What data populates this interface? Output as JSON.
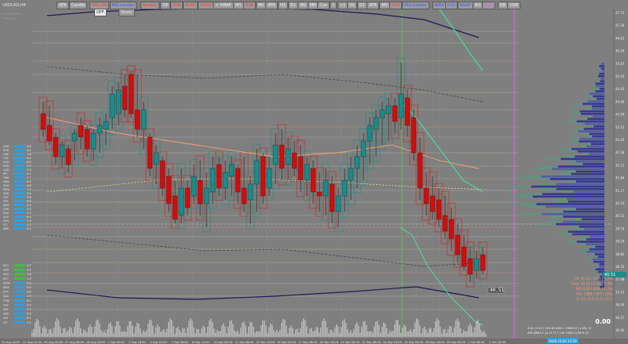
{
  "window": {
    "symbol_label": "USDCAD,H4",
    "row1_labels": [
      "—",
      "—",
      "—",
      "—",
      "—"
    ],
    "row2_labels": [
      "—",
      "—",
      "—",
      "—"
    ]
  },
  "toolbar": {
    "buttons": [
      {
        "label": "ATR",
        "color": "#f6f6f6"
      },
      {
        "label": "Candle",
        "color": "#f6f6f6"
      },
      {
        "label": "TRG DN",
        "color": "#ff3a3a"
      },
      {
        "label": "Mid London",
        "color": "#3a5aff"
      },
      {
        "label": "Weekly",
        "color": "#ff3a3a"
      },
      {
        "label": "SR",
        "color": "#f6f6f6"
      },
      {
        "label": "Q28",
        "color": "#ff3a3a"
      },
      {
        "label": "AVRP",
        "color": "#ff3a3a"
      },
      {
        "label": "VWAP",
        "color": "#ff3a3a"
      },
      {
        "label": "< VWAP",
        "color": "#f6f6f6"
      },
      {
        "label": "M1",
        "color": "#f6f6f6"
      },
      {
        "label": "Q28",
        "color": "#ff3a3a"
      },
      {
        "label": "MV",
        "color": "#f6f6f6"
      },
      {
        "label": "ATR",
        "color": "#f6f6f6"
      },
      {
        "label": "H1",
        "color": "#f6f6f6"
      },
      {
        "label": "D1",
        "color": "#f6f6f6"
      },
      {
        "label": "W1",
        "color": "#f6f6f6"
      },
      {
        "label": "MN",
        "color": "#f6f6f6"
      },
      {
        "label": "Cov",
        "color": "#f6f6f6"
      },
      {
        "label": "1",
        "color": "#f6f6f6"
      },
      {
        "label": "<1",
        "color": "#f6f6f6"
      },
      {
        "label": "D1",
        "color": "#f6f6f6"
      },
      {
        "label": "D1",
        "color": "#f6f6f6"
      },
      {
        "label": "ATR",
        "color": "#f6f6f6"
      },
      {
        "label": "MV",
        "color": "#f6f6f6"
      },
      {
        "label": "Q28",
        "color": "#ff3a3a"
      },
      {
        "label": "Mid London",
        "color": "#3a5aff"
      },
      {
        "label": "WB3",
        "color": "#3a5aff"
      },
      {
        "label": "H12",
        "color": "#3a5aff"
      },
      {
        "label": "NGAP",
        "color": "#3a5aff"
      },
      {
        "label": "W1",
        "color": "#f6f6f6"
      },
      {
        "label": "S Pa",
        "color": "#ff5aff"
      },
      {
        "label": "DB",
        "color": "#f6f6f6"
      },
      {
        "label": "COR",
        "color": "#f6f6f6"
      }
    ],
    "off_label": "OFF",
    "boxes_label": "Boxes"
  },
  "time_axis": [
    "20 Aug 2020",
    "22 Aug 12:00",
    "25 Aug 00:00",
    "27 Aug 08:00",
    "28 Aug 16:00",
    "1 Sep 00:00",
    "3 Sep 16:00",
    "4 Sep 20:00",
    "7 Sep 08:00",
    "8 Sep 12:00",
    "10 Sep 00:00",
    "11 Sep 08:00",
    "14 Sep 16:00",
    "16 Sep 00:00",
    "17 Sep 08:00",
    "18 Sep 16:00",
    "21 Sep 00:00",
    "22 Sep 08:00",
    "24 Sep 16:00",
    "25 Sep 00:00",
    "28 Sep 16:00",
    "30 Sep 00:00",
    "1 Oct 08:00",
    "2 Oct 16:00"
  ],
  "price_axis": [
    "47.75",
    "47.28",
    "46.81",
    "46.34",
    "45.87",
    "45.40",
    "44.93",
    "44.46",
    "43.99",
    "43.52",
    "43.05",
    "42.58",
    "42.11",
    "41.64",
    "41.17",
    "40.70",
    "40.23",
    "39.76",
    "39.29",
    "38.82",
    "38.35",
    "37.88",
    "37.41",
    "36.94",
    "36.47",
    "36.00"
  ],
  "current_price": "40.51",
  "pivot_label": "40.51",
  "currency_strength": {
    "rows": [
      {
        "name": "USD",
        "value": "3.6"
      },
      {
        "name": "EUR",
        "value": "4.2"
      },
      {
        "name": "GBP",
        "value": "7.8"
      },
      {
        "name": "CHF",
        "value": "5.4"
      },
      {
        "name": "AUD",
        "value": "6.0"
      },
      {
        "name": "NZD",
        "value": "3.9"
      },
      {
        "name": "CAD",
        "value": "2.9"
      },
      {
        "name": "JPY",
        "value": "5.1"
      },
      {
        "name": "CNH",
        "value": "2.7"
      },
      {
        "name": "HKD",
        "value": "6.3"
      },
      {
        "name": "SGD",
        "value": "4.8"
      },
      {
        "name": "MXN",
        "value": "7.1"
      },
      {
        "name": "ZAR",
        "value": "3.4"
      },
      {
        "name": "TRY",
        "value": "5.8"
      },
      {
        "name": "SEK",
        "value": "6.6"
      },
      {
        "name": "NOK",
        "value": "4.5"
      },
      {
        "name": "DKK",
        "value": "2.2"
      },
      {
        "name": "PLN",
        "value": "3.7"
      },
      {
        "name": "XAU",
        "value": "6.9"
      },
      {
        "name": "XAG",
        "value": "7.4"
      },
      {
        "name": "XTI",
        "value": "5.2"
      },
      {
        "name": "XBR",
        "value": "3.1"
      }
    ],
    "lower_rows": [
      {
        "name": "WTI",
        "value": "2.7"
      },
      {
        "name": "UKO",
        "value": "3.2"
      },
      {
        "name": "NGC",
        "value": "1.8"
      },
      {
        "name": "BTC",
        "value": "1.3"
      },
      {
        "name": "DOW",
        "value": "4.6"
      },
      {
        "name": "NDX",
        "value": "5.0"
      },
      {
        "name": "SPX",
        "value": "3.8"
      },
      {
        "name": "DAX",
        "value": "4.9"
      },
      {
        "name": "FTSE",
        "value": "6.1"
      },
      {
        "name": "CAC",
        "value": "2.5"
      },
      {
        "name": "NKY",
        "value": "3.3"
      },
      {
        "name": "ASX",
        "value": "5.5"
      },
      {
        "name": "HSI",
        "value": "6.7"
      },
      {
        "name": "STI",
        "value": "7.2"
      }
    ]
  },
  "info_panel": {
    "lines": [
      "Hi: 41.72 | 0.61 | 1.5%",
      "Prev: 40.51 | 0.42 | 1.0%",
      "Rel: 0.50 | 0.61 | 1.2%",
      "Cnt: 1984 | 357 | 15%",
      "V: 13 | 1.4 | 1.1 | 11.1"
    ],
    "big_value": "0.00",
    "bottom_lines": [
      "0.01  |  0.01  |  103.40 USD = 10500.0  |  1.0%  |  6",
      "ATR D867.4  |  $ 1177.7  |  Sh 2550.3  |  SR 0.15"
    ],
    "timestamp": "2020.10.02 23:59"
  },
  "colors": {
    "background": "#7f7f7f",
    "bull": "#1e8a8a",
    "bear": "#cc1010",
    "volume_profile": "#2a2a9a",
    "magenta_line": "#ff55ff"
  }
}
